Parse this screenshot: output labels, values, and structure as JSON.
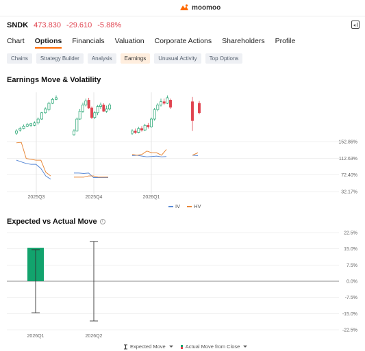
{
  "app": {
    "brand": "moomoo",
    "brand_color": "#ff6a00"
  },
  "quote": {
    "ticker": "SNDK",
    "price": "473.830",
    "change": "-29.610",
    "percent": "-5.88%",
    "down_color": "#e0434f"
  },
  "tabs": [
    {
      "label": "Chart",
      "active": false
    },
    {
      "label": "Options",
      "active": true
    },
    {
      "label": "Financials",
      "active": false
    },
    {
      "label": "Valuation",
      "active": false
    },
    {
      "label": "Corporate Actions",
      "active": false
    },
    {
      "label": "Shareholders",
      "active": false
    },
    {
      "label": "Profile",
      "active": false
    }
  ],
  "subtabs": [
    {
      "label": "Chains",
      "active": false
    },
    {
      "label": "Strategy Builder",
      "active": false
    },
    {
      "label": "Analysis",
      "active": false
    },
    {
      "label": "Earnings",
      "active": true
    },
    {
      "label": "Unusual Activity",
      "active": false
    },
    {
      "label": "Top Options",
      "active": false
    }
  ],
  "section1": {
    "title": "Earnings Move & Volatility"
  },
  "section2": {
    "title": "Expected vs Actual Move",
    "info_icon": "info-icon"
  },
  "legend1": {
    "iv": "IV",
    "hv": "HV"
  },
  "legend2": {
    "expected": "Expected Move",
    "actual": "Actual Move from Close"
  },
  "colors": {
    "up": "#1aa06b",
    "down": "#e0434f",
    "iv": "#5a8ad6",
    "hv": "#e8893a",
    "grid": "#e6e6e6",
    "bar": "#12a36d"
  },
  "chart_data": [
    {
      "type": "line",
      "title": "Earnings Move & Volatility",
      "categories": [
        "2025Q3",
        "2025Q4",
        "2026Q1"
      ],
      "y_ticks": [
        "152.86%",
        "112.63%",
        "72.40%",
        "32.17%"
      ],
      "ylim": [
        32.17,
        152.86
      ],
      "series": [
        {
          "name": "IV",
          "segments": [
            [
              [
                0,
                108
              ],
              [
                1,
                104
              ],
              [
                2,
                100
              ],
              [
                3,
                98
              ],
              [
                4,
                98
              ],
              [
                5,
                88
              ],
              [
                6,
                70
              ],
              [
                7,
                62
              ]
            ],
            [
              [
                0,
                77
              ],
              [
                1,
                77
              ],
              [
                2,
                76
              ],
              [
                3,
                77
              ],
              [
                4,
                66
              ],
              [
                5,
                66
              ],
              [
                6,
                66
              ],
              [
                7,
                66
              ]
            ],
            [
              [
                0,
                119
              ],
              [
                1,
                120
              ],
              [
                2,
                118
              ],
              [
                3,
                116
              ],
              [
                4,
                117
              ],
              [
                5,
                118
              ],
              [
                6,
                116
              ],
              [
                7,
                117
              ]
            ],
            [
              [
                0,
                120
              ],
              [
                1,
                119
              ]
            ]
          ]
        },
        {
          "name": "HV",
          "segments": [
            [
              [
                0,
                150
              ],
              [
                1,
                151
              ],
              [
                2,
                112
              ],
              [
                3,
                110
              ],
              [
                4,
                108
              ],
              [
                5,
                108
              ],
              [
                6,
                79
              ],
              [
                7,
                70
              ]
            ],
            [
              [
                0,
                67
              ],
              [
                1,
                67
              ],
              [
                2,
                67
              ],
              [
                3,
                70
              ],
              [
                4,
                70
              ],
              [
                5,
                67
              ],
              [
                6,
                67
              ],
              [
                7,
                67
              ]
            ],
            [
              [
                0,
                122
              ],
              [
                1,
                120
              ],
              [
                2,
                122
              ],
              [
                3,
                130
              ],
              [
                4,
                126
              ],
              [
                5,
                126
              ],
              [
                6,
                120
              ],
              [
                7,
                134
              ]
            ],
            [
              [
                0,
                120
              ],
              [
                1,
                126
              ]
            ]
          ]
        }
      ],
      "candles": [
        [
          {
            "o": 2,
            "c": 5,
            "h": 7,
            "l": 0
          },
          {
            "o": 6,
            "c": 8,
            "h": 10,
            "l": 4
          },
          {
            "o": 8,
            "c": 11,
            "h": 13,
            "l": 7
          },
          {
            "o": 11,
            "c": 13,
            "h": 15,
            "l": 10
          },
          {
            "o": 12,
            "c": 14,
            "h": 15,
            "l": 10
          },
          {
            "o": 12,
            "c": 15,
            "h": 17,
            "l": 11
          },
          {
            "o": 15,
            "c": 20,
            "h": 22,
            "l": 13
          },
          {
            "o": 20,
            "c": 28,
            "h": 29,
            "l": 19
          },
          {
            "o": 28,
            "c": 33,
            "h": 35,
            "l": 27
          },
          {
            "o": 32,
            "c": 40,
            "h": 42,
            "l": 30
          },
          {
            "o": 40,
            "c": 45,
            "h": 47,
            "l": 39
          },
          {
            "o": 45,
            "c": 47,
            "h": 50,
            "l": 44
          }
        ],
        [
          {
            "o": 0,
            "c": 5,
            "h": 7,
            "l": -1
          },
          {
            "o": 5,
            "c": 20,
            "h": 22,
            "l": 4
          },
          {
            "o": 20,
            "c": 30,
            "h": 33,
            "l": 19
          },
          {
            "o": 30,
            "c": 38,
            "h": 41,
            "l": 28
          },
          {
            "o": 38,
            "c": 43,
            "h": 46,
            "l": 36
          },
          {
            "o": 44,
            "c": 34,
            "h": 47,
            "l": 33
          },
          {
            "o": 34,
            "c": 22,
            "h": 36,
            "l": 20
          },
          {
            "o": 22,
            "c": 28,
            "h": 30,
            "l": 20
          },
          {
            "o": 28,
            "c": 36,
            "h": 38,
            "l": 25
          },
          {
            "o": 36,
            "c": 38,
            "h": 41,
            "l": 33
          },
          {
            "o": 38,
            "c": 30,
            "h": 40,
            "l": 29
          },
          {
            "o": 30,
            "c": 33,
            "h": 37,
            "l": 28
          },
          {
            "o": 33,
            "c": 38,
            "h": 40,
            "l": 31
          }
        ],
        [
          {
            "o": 2,
            "c": 5,
            "h": 7,
            "l": 0
          },
          {
            "o": 5,
            "c": 3,
            "h": 8,
            "l": 1
          },
          {
            "o": 3,
            "c": 8,
            "h": 10,
            "l": 2
          },
          {
            "o": 8,
            "c": 6,
            "h": 11,
            "l": 4
          },
          {
            "o": 6,
            "c": 12,
            "h": 14,
            "l": 5
          },
          {
            "o": 12,
            "c": 10,
            "h": 15,
            "l": 8
          },
          {
            "o": 10,
            "c": 20,
            "h": 22,
            "l": 9
          },
          {
            "o": 20,
            "c": 32,
            "h": 34,
            "l": 18
          },
          {
            "o": 32,
            "c": 38,
            "h": 40,
            "l": 30
          },
          {
            "o": 38,
            "c": 42,
            "h": 46,
            "l": 36
          },
          {
            "o": 42,
            "c": 40,
            "h": 46,
            "l": 38
          },
          {
            "o": 40,
            "c": 47,
            "h": 50,
            "l": 39
          },
          {
            "o": 44,
            "c": 35,
            "h": 46,
            "l": 33
          }
        ],
        [
          {
            "o": 42,
            "c": 18,
            "h": 48,
            "l": 5
          },
          {
            "o": 40,
            "c": 28,
            "h": 43,
            "l": 26
          }
        ]
      ]
    },
    {
      "type": "bar",
      "title": "Expected vs Actual Move",
      "categories": [
        "2026Q1",
        "2026Q2"
      ],
      "y_ticks": [
        "22.5%",
        "15.0%",
        "7.5%",
        "0.0%",
        "-7.5%",
        "-15.0%",
        "-22.5%"
      ],
      "ylim": [
        -22.5,
        22.5
      ],
      "series": [
        {
          "name": "Expected Move",
          "values": [
            14.6,
            18.4
          ]
        },
        {
          "name": "Actual Move from Close",
          "values": [
            15.5,
            null
          ]
        }
      ]
    }
  ]
}
